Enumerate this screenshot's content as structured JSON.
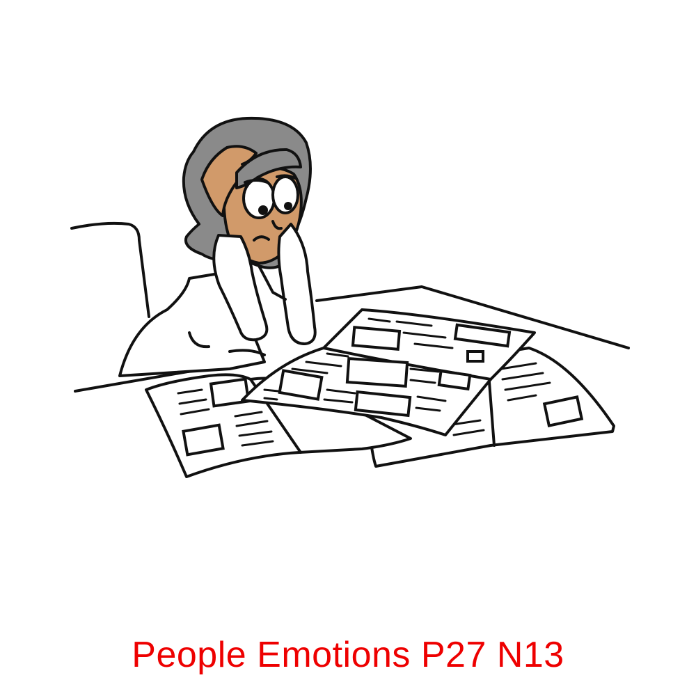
{
  "caption": "People Emotions P27 N13",
  "colors": {
    "caption": "#ee0000",
    "hair": "#8a8a8a",
    "skin": "#d19a6a",
    "outline": "#111111",
    "paper": "#ffffff"
  }
}
